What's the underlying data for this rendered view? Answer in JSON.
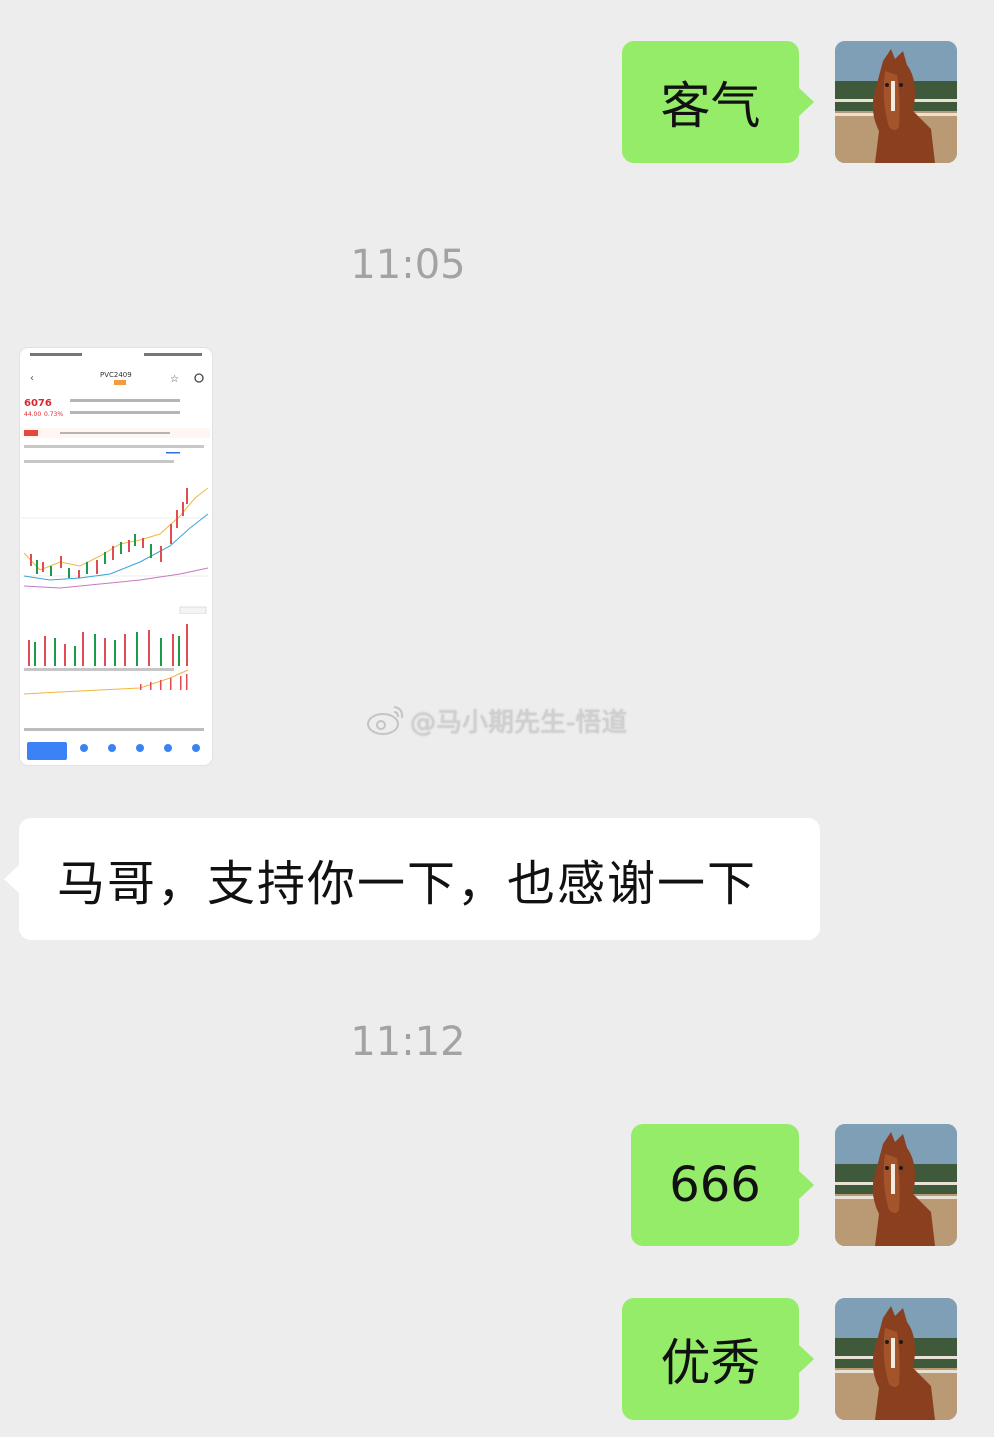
{
  "messages": {
    "m1": {
      "text": "客气"
    },
    "t1": {
      "text": "11:05"
    },
    "m2": {
      "symbol_ticker": "PVC2409",
      "last_price": "6076",
      "change": "44.00",
      "change_pct": "0.73%"
    },
    "m3": {
      "text": "马哥，支持你一下，也感谢一下"
    },
    "t2": {
      "text": "11:12"
    },
    "m4": {
      "text": "666"
    },
    "m5": {
      "text": "优秀"
    }
  },
  "watermark": {
    "text": "@马小期先生-悟道",
    "icon": "weibo-icon"
  },
  "colors": {
    "background": "#ededed",
    "outgoing_bubble": "#95ec69",
    "incoming_bubble": "#ffffff",
    "timestamp": "#a3a3a3"
  }
}
